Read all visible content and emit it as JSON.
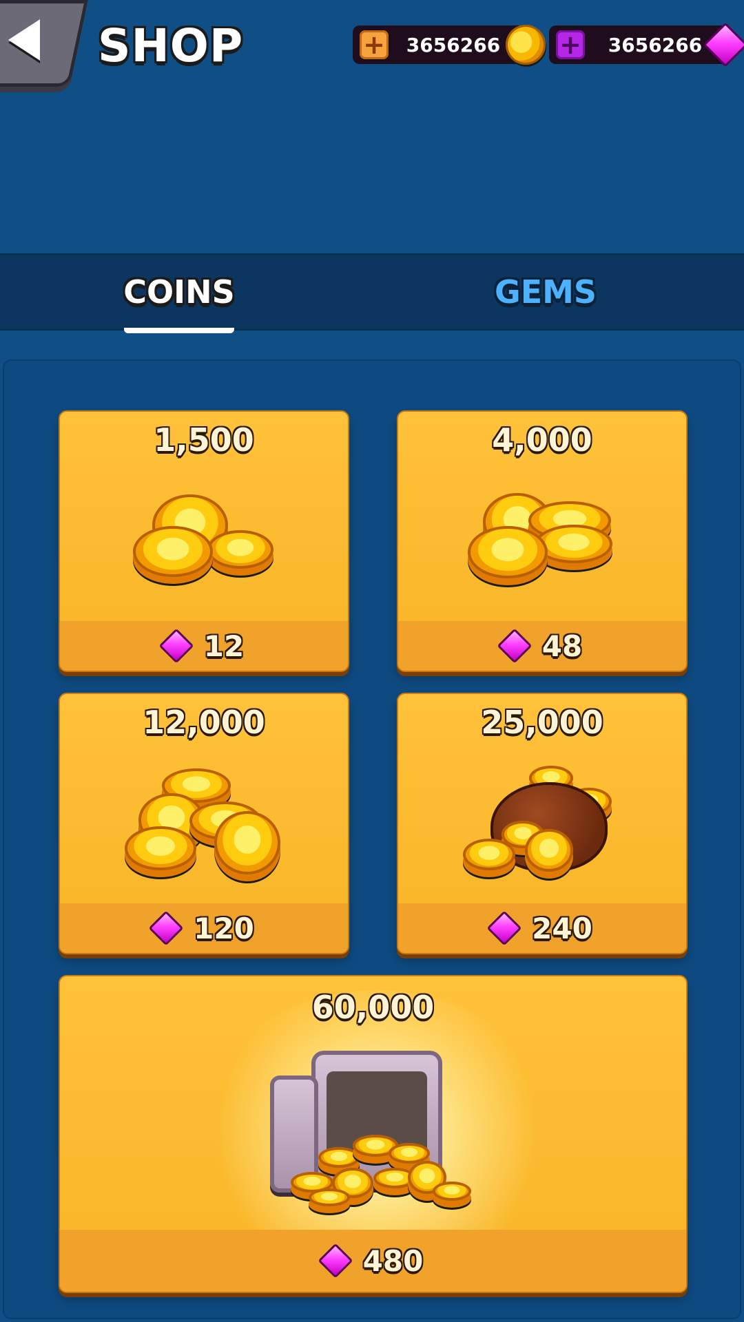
{
  "header": {
    "title": "SHOP",
    "coins_balance": "3656266",
    "gems_balance": "3656266",
    "plus_label": "+"
  },
  "tabs": [
    {
      "label": "COINS",
      "active": true
    },
    {
      "label": "GEMS",
      "active": false
    }
  ],
  "offers": [
    {
      "amount": "1,500",
      "price": "12",
      "icon": "coin-pile-small-icon"
    },
    {
      "amount": "4,000",
      "price": "48",
      "icon": "coin-stack-medium-icon"
    },
    {
      "amount": "12,000",
      "price": "120",
      "icon": "coin-pile-large-icon"
    },
    {
      "amount": "25,000",
      "price": "240",
      "icon": "coin-bag-icon"
    },
    {
      "amount": "60,000",
      "price": "480",
      "icon": "coin-safe-icon"
    }
  ],
  "colors": {
    "background": "#0f4f86",
    "tabbar": "#0c3660",
    "card": "#ffc23a",
    "price_bar": "#f0a22a",
    "gem": "#ff40ff",
    "coin": "#ffcc10"
  }
}
